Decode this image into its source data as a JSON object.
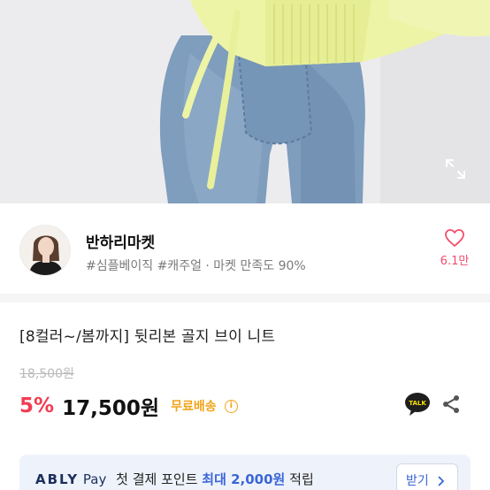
{
  "hero": {
    "image_desc_icon": "expand-icon"
  },
  "seller": {
    "name": "반하리마켓",
    "tags": "#심플베이직 #캐주얼 · 마켓 만족도 90%",
    "favorite_icon": "heart-icon",
    "favorite_count": "6.1만"
  },
  "product": {
    "title": "[8컬러~/봄까지] 뒷리본 골지 브이 니트",
    "original_price": "18,500원",
    "discount": "5%",
    "price": "17,500원",
    "shipping": "무료배송",
    "info_icon_glyph": "i",
    "talk_label": "TALK"
  },
  "promo": {
    "brand": "ABLY",
    "pay": "Pay",
    "text_before": "첫 결제 포인트",
    "highlight": "최대 2,000원",
    "text_after": "적립",
    "button_label": "받기",
    "button_icon": "chevron-right-icon"
  },
  "colors": {
    "discount": "#f23c52",
    "shipping": "#f2a41a",
    "favorite": "#f24d6b",
    "promo_bg": "#eef3fb",
    "promo_accent": "#3b66d8"
  }
}
